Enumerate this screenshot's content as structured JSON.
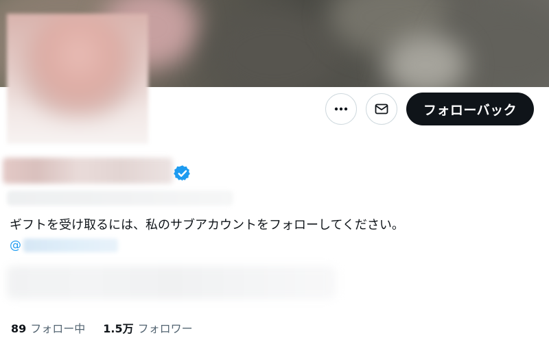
{
  "header": {
    "more_icon": "more-horizontal-icon",
    "mail_icon": "envelope-icon",
    "follow_back_label": "フォローバック"
  },
  "profile": {
    "verified_icon": "verified-badge-icon",
    "bio": "ギフトを受け取るには、私のサブアカウントをフォローしてください。",
    "mention_prefix": "@"
  },
  "stats": {
    "following": {
      "count": "89",
      "label": "フォロー中"
    },
    "followers": {
      "count": "1.5万",
      "label": "フォロワー"
    }
  },
  "colors": {
    "accent": "#1d9bf0",
    "button_dark": "#0f1419",
    "text_primary": "#0f1419",
    "text_secondary": "#536471",
    "border": "#cfd9de"
  }
}
